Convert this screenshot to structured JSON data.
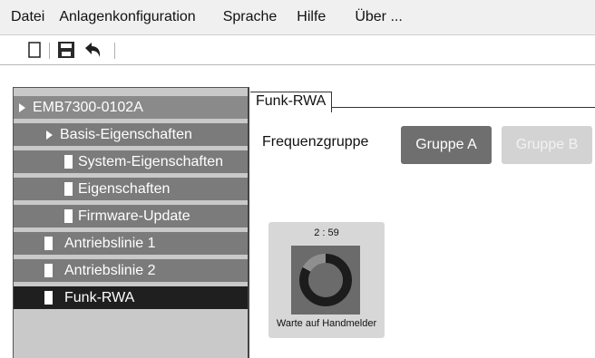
{
  "menubar": {
    "items": [
      "Datei",
      "Anlagenkonfiguration",
      "Sprache",
      "Hilfe",
      "Über ..."
    ]
  },
  "toolbar": {
    "icons": [
      "new-document-icon",
      "save-icon",
      "undo-icon"
    ]
  },
  "sidebar": {
    "items": [
      {
        "label": "EMB7300-0102A",
        "kind": "root",
        "icon": "arrow"
      },
      {
        "label": "Basis-Eigenschaften",
        "kind": "group",
        "icon": "arrow"
      },
      {
        "label": "System-Eigenschaften",
        "kind": "leaf",
        "icon": "doc"
      },
      {
        "label": "Eigenschaften",
        "kind": "leaf",
        "icon": "doc"
      },
      {
        "label": "Firmware-Update",
        "kind": "leaf",
        "icon": "doc"
      },
      {
        "label": "Antriebslinie 1",
        "kind": "node",
        "icon": "doc"
      },
      {
        "label": "Antriebslinie 2",
        "kind": "node",
        "icon": "doc"
      },
      {
        "label": "Funk-RWA",
        "kind": "node",
        "icon": "doc",
        "selected": true
      }
    ]
  },
  "main": {
    "tab_label": "Funk-RWA",
    "frequency_label": "Frequenzgruppe",
    "group_a_label": "Gruppe A",
    "group_b_label": "Gruppe B",
    "card": {
      "timer": "2 : 59",
      "caption": "Warte auf Handmelder",
      "progress": 0.83
    }
  },
  "colors": {
    "selected_bg": "#1f1f1f",
    "item_bg": "#7b7b7b",
    "active_button": "#6f6f6f",
    "inactive_button": "#d3d3d3"
  }
}
